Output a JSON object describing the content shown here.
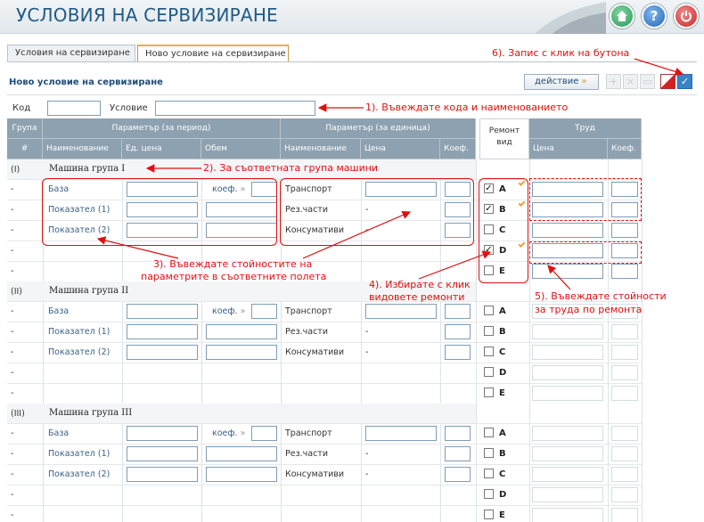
{
  "header": {
    "title": "УСЛОВИЯ НА СЕРВИЗИРАНЕ",
    "home_icon": "home-icon",
    "help_label": "?",
    "power_icon": "power-icon"
  },
  "tabs": [
    "Условия на сервизиране",
    "Ново условие на сервизиране"
  ],
  "section_title": "Ново условие на сервизиране",
  "action_button": "действие",
  "form": {
    "code_label": "Код",
    "condition_label": "Условие",
    "code_value": "",
    "condition_value": ""
  },
  "table_header": {
    "group": "Група",
    "hash": "#",
    "param_period": "Параметър (за период)",
    "param_unit": "Параметър (за единица)",
    "repair_line1": "Ремонт",
    "repair_line2": "вид",
    "labor": "Труд",
    "name": "Наименование",
    "unit_price": "Ед. цена",
    "volume": "Обем",
    "name2": "Наименование",
    "price": "Цена",
    "coef": "Коеф.",
    "labor_price": "Цена",
    "labor_coef": "Коеф."
  },
  "groups": [
    {
      "num": "(I)",
      "name": "Машина група I"
    },
    {
      "num": "(II)",
      "name": "Машина група II"
    },
    {
      "num": "(III)",
      "name": "Машина група III"
    }
  ],
  "row_dash": "-",
  "period_params": [
    "База",
    "Показател (1)",
    "Показател (2)"
  ],
  "unit_params": [
    "Транспорт",
    "Рез.части",
    "Консумативи"
  ],
  "koef_label": "коеф.",
  "repair_types": [
    "A",
    "B",
    "C",
    "D",
    "E"
  ],
  "checked_group1": [
    "A",
    "B",
    "D"
  ],
  "annotations": {
    "a1": "1). Въвеждате кода и наименованието",
    "a2": "2). За съответната група машини",
    "a3_l1": "3). Въвеждате стойностите на",
    "a3_l2": "параметрите в съответните полета",
    "a4_l1": "4). Избирате с клик",
    "a4_l2": "видовете ремонти",
    "a5_l1": "5). Въвеждате стойности",
    "a5_l2": "за труда по ремонта",
    "a6": "6). Запис с клик на бутона"
  },
  "colors": {
    "accent": "#1f5a86",
    "header_bg": "#8ea1b0",
    "annotation": "#e01010",
    "tab_active": "#e4b04a"
  }
}
